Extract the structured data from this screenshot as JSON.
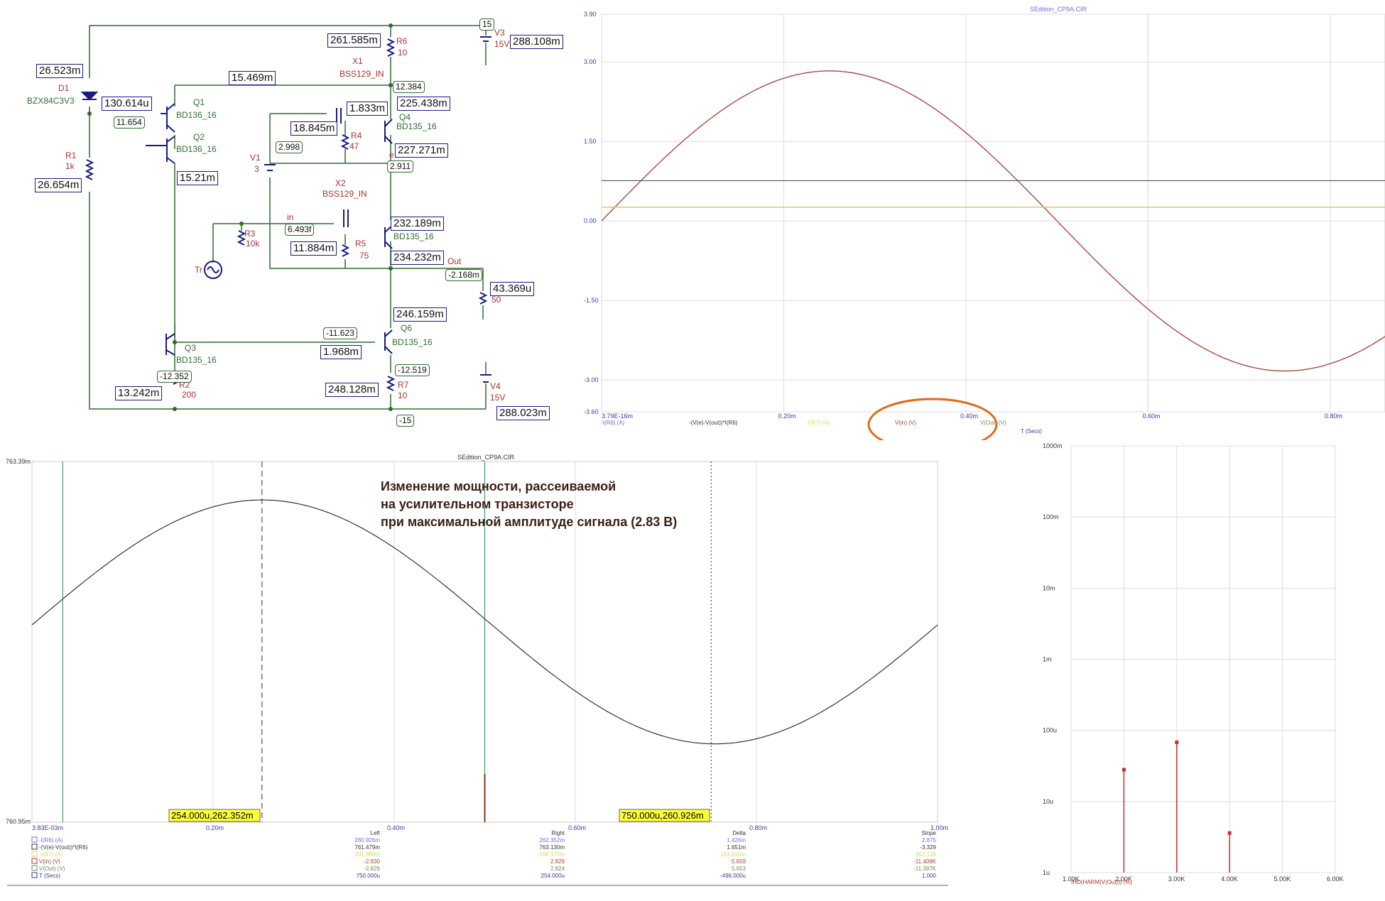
{
  "schematic": {
    "parts": {
      "D1": {
        "ref": "D1",
        "model": "BZX84C3V3"
      },
      "R1": {
        "ref": "R1",
        "val": "1k"
      },
      "Q1": {
        "ref": "Q1",
        "model": "BD136_16"
      },
      "Q2": {
        "ref": "Q2",
        "model": "BD136_16"
      },
      "Q3": {
        "ref": "Q3",
        "model": "BD135_16"
      },
      "R2": {
        "ref": "R2",
        "val": "200"
      },
      "R6": {
        "ref": "R6",
        "val": "10"
      },
      "V3": {
        "ref": "V3",
        "val": "15V"
      },
      "X1": {
        "ref": "X1",
        "model": "BSS129_IN"
      },
      "Q4": {
        "ref": "Q4",
        "model": "BD135_16"
      },
      "R4": {
        "ref": "R4",
        "val": "47"
      },
      "V1": {
        "ref": "V1",
        "val": "3"
      },
      "X2": {
        "ref": "X2",
        "model": "BSS129_IN"
      },
      "Q5": {
        "ref": "",
        "model": "BD135_16"
      },
      "R5": {
        "ref": "R5",
        "val": "75"
      },
      "R3": {
        "ref": "R3",
        "val": "10k"
      },
      "Tr": {
        "ref": "Tr"
      },
      "R8": {
        "ref": "",
        "val": "50"
      },
      "Q6": {
        "ref": "Q6",
        "model": "BD135_16"
      },
      "R7": {
        "ref": "R7",
        "val": "10"
      },
      "V4": {
        "ref": "V4",
        "val": "15V"
      }
    },
    "nets": {
      "in": "in",
      "out": "Out",
      "e": "e"
    },
    "current_probes": [
      {
        "id": "d1",
        "text": "26.523m"
      },
      {
        "id": "q1",
        "text": "130.614u"
      },
      {
        "id": "top",
        "text": "15.469m"
      },
      {
        "id": "r6",
        "text": "261.585m"
      },
      {
        "id": "v3",
        "text": "288.108m"
      },
      {
        "id": "x1",
        "text": "1.833m"
      },
      {
        "id": "q4",
        "text": "225.438m"
      },
      {
        "id": "r4",
        "text": "18.845m"
      },
      {
        "id": "q4e",
        "text": "227.271m"
      },
      {
        "id": "r1",
        "text": "26.654m"
      },
      {
        "id": "q2",
        "text": "15.21m"
      },
      {
        "id": "q5",
        "text": "232.189m"
      },
      {
        "id": "r5",
        "text": "11.884m"
      },
      {
        "id": "q5e",
        "text": "234.232m"
      },
      {
        "id": "out",
        "text": "43.369u"
      },
      {
        "id": "q6",
        "text": "246.159m"
      },
      {
        "id": "q3",
        "text": "1.968m"
      },
      {
        "id": "r7",
        "text": "248.128m"
      },
      {
        "id": "r2",
        "text": "13.242m"
      },
      {
        "id": "v4",
        "text": "288.023m"
      }
    ],
    "voltage_probes": [
      {
        "id": "v15",
        "text": "15"
      },
      {
        "id": "n12",
        "text": "12.384"
      },
      {
        "id": "nb1",
        "text": "11.654"
      },
      {
        "id": "nv1",
        "text": "2.998"
      },
      {
        "id": "ne",
        "text": "2.911"
      },
      {
        "id": "nin",
        "text": "6.493f"
      },
      {
        "id": "nout",
        "text": "-2.168m"
      },
      {
        "id": "nq6b",
        "text": "-11.623"
      },
      {
        "id": "nq3",
        "text": "-12.352"
      },
      {
        "id": "nq6e",
        "text": "-12.519"
      },
      {
        "id": "nm15",
        "text": "-15"
      }
    ]
  },
  "waveform": {
    "title": "SEdition_CP9A.CIR",
    "y_ticks": [
      "3.90",
      "3.00",
      "1.50",
      "0.00",
      "-1.50",
      "-3.00",
      "-3.60"
    ],
    "x_ticks": [
      "3.79E-16m",
      "0.20m",
      "0.40m",
      "0.60m",
      "0.80m"
    ],
    "legend": [
      "-I(R6) (A)",
      "-(V(e)-V(out))*I(R6)",
      "-I(R7) (A)",
      "V(in) (V)",
      "V(Out) (V)",
      "T (Secs)"
    ]
  },
  "power_plot": {
    "title": "SEdition_CP9A.CIR",
    "caption": [
      "Изменение мощности, рассеиваемой",
      "на усилительном транзисторе",
      "при максимальной амплитуде сигнала (2.83 В)"
    ],
    "y_top": "763.39m",
    "y_bottom": "760.95m",
    "x_ticks": [
      "3.83E-03m",
      "0.20m",
      "0.40m",
      "0.60m",
      "0.80m",
      "1.00m"
    ],
    "cursor_left": "254.000u,262.352m",
    "cursor_right": "750.000u,260.926m",
    "table": {
      "headers": [
        "Left",
        "Right",
        "Delta",
        "Slope"
      ],
      "rows": [
        {
          "name": "-I(R6) (A)",
          "left": "260.926m",
          "right": "262.352m",
          "delta": "1.426m",
          "slope": "2.875"
        },
        {
          "name": "-(V(e)-V(out))*I(R6)",
          "left": "761.479m",
          "right": "763.130m",
          "delta": "1.651m",
          "slope": "-3.329"
        },
        {
          "name": "-I(R7) (A)",
          "left": "281.988m",
          "right": "198.370m",
          "delta": "-183.616m",
          "slope": "362.128"
        },
        {
          "name": "V(in) (V)",
          "left": "-2.830",
          "right": "2.829",
          "delta": "5.659",
          "slope": "-11.409K"
        },
        {
          "name": "V(Out) (V)",
          "left": "-2.829",
          "right": "2.824",
          "delta": "5.653",
          "slope": "-11.397K"
        },
        {
          "name": "T (Secs)",
          "left": "750.000u",
          "right": "254.000u",
          "delta": "-496.000u",
          "slope": "1.000"
        }
      ]
    }
  },
  "harmonics": {
    "y_ticks": [
      "1000m",
      "100m",
      "10m",
      "1m",
      "100u",
      "10u",
      "1u"
    ],
    "x_ticks": [
      "1.00K",
      "2.00K",
      "3.00K",
      "4.00K",
      "5.00K",
      "6.00K"
    ],
    "legend": "IHD(HARM(V(Out))) (%)"
  },
  "chart_data": [
    {
      "type": "line",
      "title": "SEdition_CP9A.CIR",
      "xlabel": "T (Secs)",
      "ylim": [
        -3.6,
        3.9
      ],
      "xlim": [
        0,
        0.86
      ],
      "series": [
        {
          "name": "V(Out) (V)",
          "color": "#6b8e50",
          "amplitude": 2.83,
          "freq_per_ms": 1
        },
        {
          "name": "V(in) (V)",
          "color": "#b33a3a",
          "amplitude": 2.83,
          "freq_per_ms": 1
        },
        {
          "name": "-I(R6) (A)",
          "color": "#6d6dd8",
          "value": 0.26
        },
        {
          "name": "-I(R7) (A)",
          "color": "#d8d860",
          "value": 0.26
        },
        {
          "name": "-(V(e)-V(out))*I(R6)",
          "color": "#555555",
          "value": 0.76
        }
      ]
    },
    {
      "type": "line",
      "title": "SEdition_CP9A.CIR",
      "xlabel": "T (Secs)",
      "ylim": [
        0.76095,
        0.76339
      ],
      "xlim": [
        0,
        1.0
      ],
      "series": [
        {
          "name": "-(V(e)-V(out))*I(R6)",
          "min": 0.76148,
          "max": 0.76313,
          "peak_at_ms": 0.254,
          "trough_at_ms": 0.75
        }
      ]
    },
    {
      "type": "bar",
      "title": "",
      "xlabel": "",
      "ylabel": "IHD(HARM(V(Out))) (%)",
      "ylim": [
        1e-06,
        1
      ],
      "log_y": true,
      "categories": [
        "2.00K",
        "3.00K",
        "4.00K"
      ],
      "values": [
        2.8e-05,
        6.8e-05,
        3.6e-06
      ]
    }
  ],
  "colors": {
    "schematic_wire": "#2f6b2f",
    "schematic_symbol": "#1a1a80",
    "label_green": "#2f6f2f",
    "label_red": "#b03030",
    "probe_border": "#1a1a80",
    "orange_circle": "#e06a1a",
    "cursor_yellow": "#ffff33"
  }
}
